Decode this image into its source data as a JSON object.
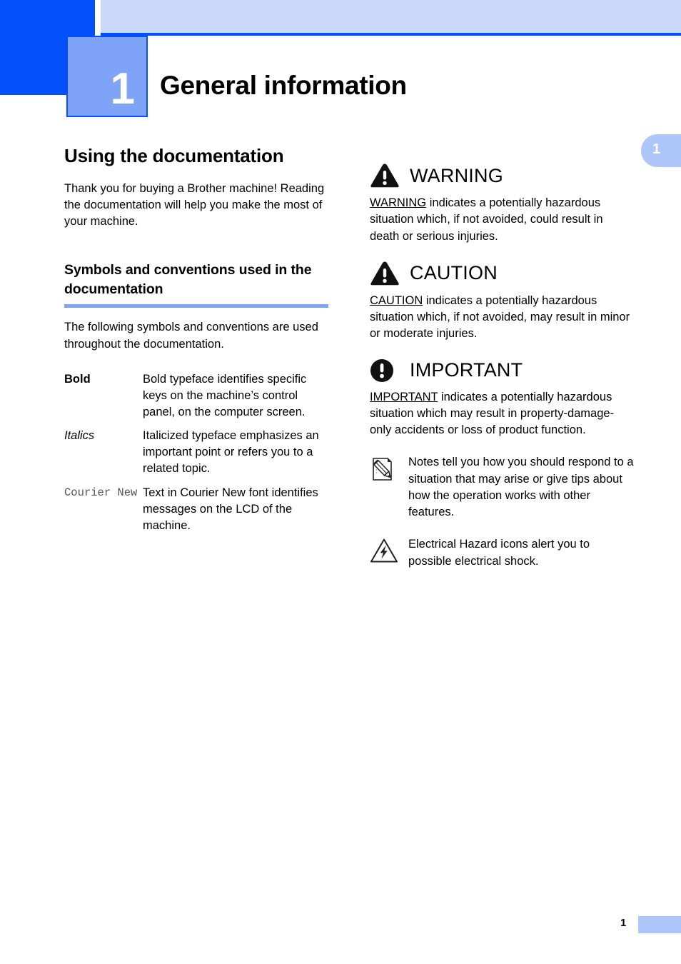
{
  "header": {
    "chapter_number": "1",
    "chapter_title": "General information",
    "side_tab_number": "1"
  },
  "left_column": {
    "section_title": "Using the documentation",
    "intro_paragraph": "Thank you for buying a Brother machine! Reading the documentation will help you make the most of your machine.",
    "subsection_title": "Symbols and conventions used in the documentation",
    "subsection_intro": "The following symbols and conventions are used throughout the documentation.",
    "definitions": [
      {
        "term": "Bold",
        "style": "bold",
        "description": "Bold typeface identifies specific keys on the machine’s control panel, on the computer screen."
      },
      {
        "term": "Italics",
        "style": "italic",
        "description": "Italicized typeface emphasizes an important point or refers you to a related topic."
      },
      {
        "term": "Courier New",
        "style": "mono",
        "description": "Text in Courier New font identifies messages on the LCD of the machine."
      }
    ]
  },
  "right_column": {
    "alerts": [
      {
        "icon": "warning-triangle-icon",
        "label": "WARNING",
        "keyword": "WARNING",
        "body_rest": " indicates a potentially hazardous situation which, if not avoided, could result in death or serious injuries."
      },
      {
        "icon": "caution-triangle-icon",
        "label": "CAUTION",
        "keyword": "CAUTION",
        "body_rest": " indicates a potentially hazardous situation which, if not avoided, may result in minor or moderate injuries."
      },
      {
        "icon": "important-circle-icon",
        "label": "IMPORTANT",
        "keyword": "IMPORTANT",
        "body_rest": " indicates a potentially hazardous situation which may result in property-damage-only accidents or loss of product function."
      }
    ],
    "notes": [
      {
        "icon": "note-pencil-icon",
        "text": "Notes tell you how you should respond to a situation that may arise or give tips about how the operation works with other features."
      },
      {
        "icon": "electrical-hazard-icon",
        "text": "Electrical Hazard icons alert you to possible electrical shock."
      }
    ]
  },
  "footer": {
    "page_number": "1"
  },
  "colors": {
    "deep_blue": "#0450FB",
    "mid_blue": "#7FA3F7",
    "light_blue": "#CBD9F8",
    "tab_blue": "#AFC6FB"
  }
}
